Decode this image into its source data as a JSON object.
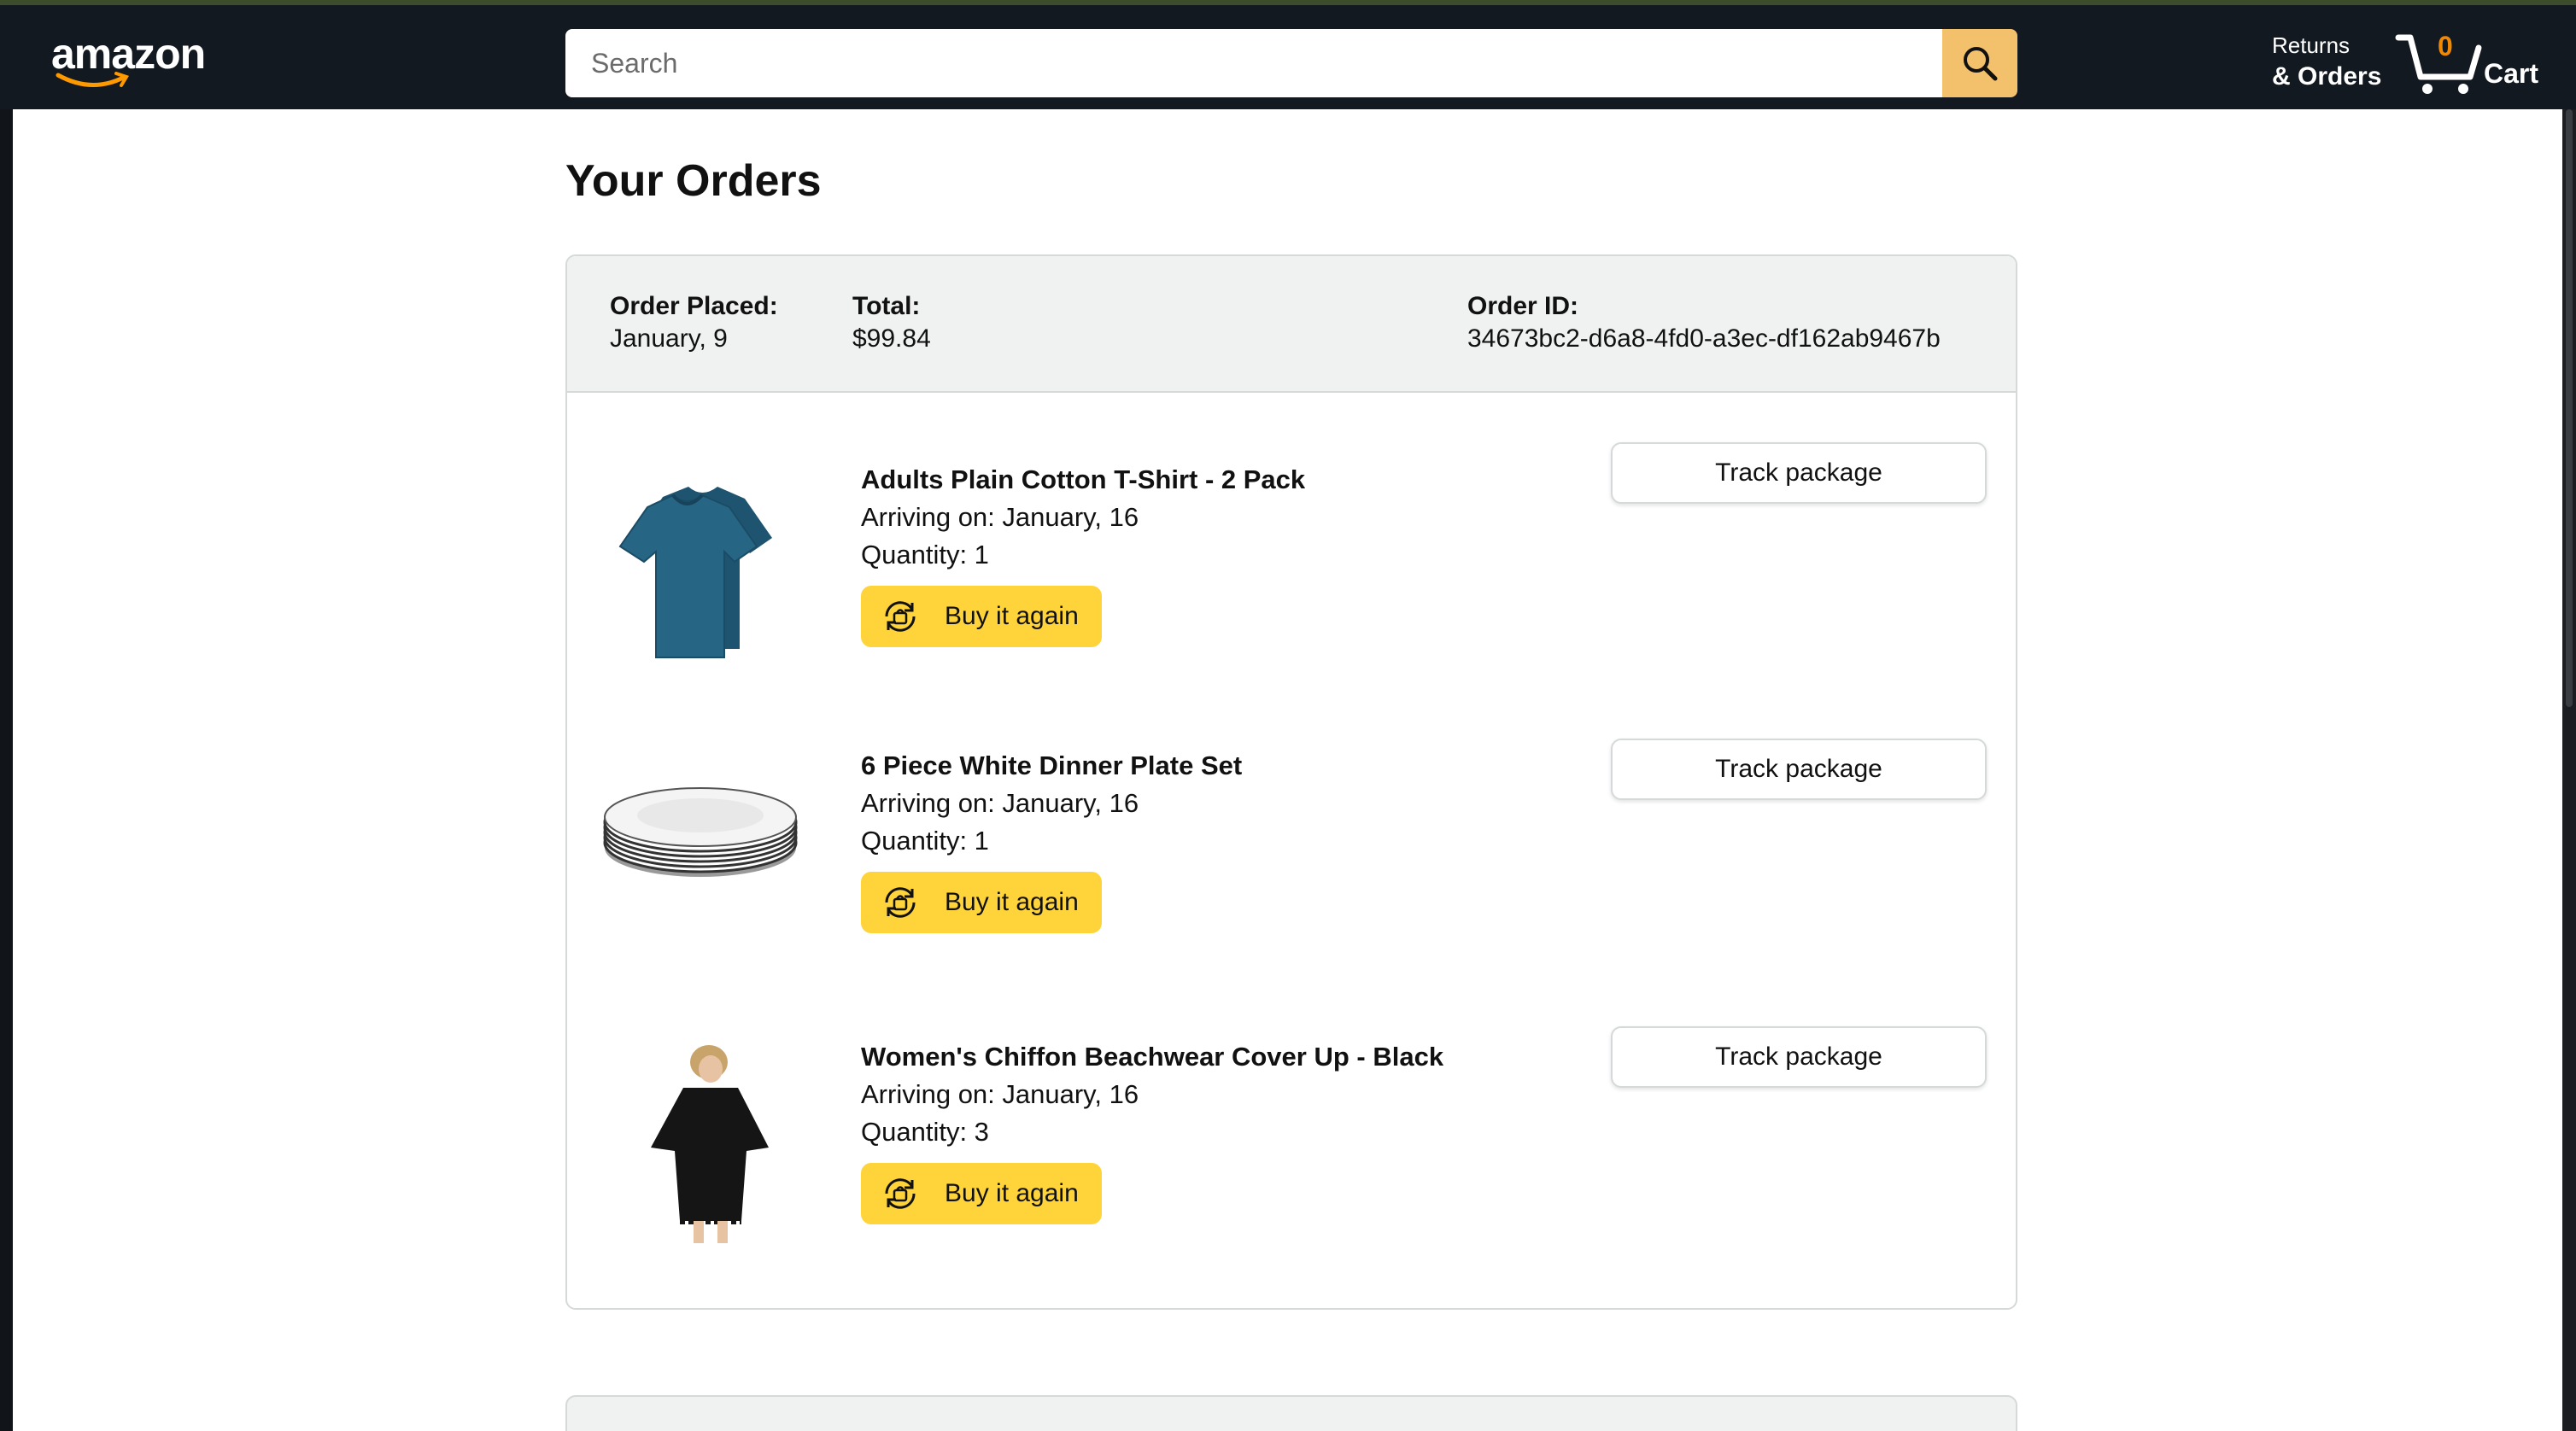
{
  "header": {
    "logo": "amazon",
    "search_placeholder": "Search",
    "returns_line1": "Returns",
    "returns_line2": "& Orders",
    "cart_count": "0",
    "cart_label": "Cart"
  },
  "page": {
    "title": "Your Orders"
  },
  "order": {
    "placed_label": "Order Placed:",
    "placed_value": "January, 9",
    "total_label": "Total:",
    "total_value": "$99.84",
    "id_label": "Order ID:",
    "id_value": "34673bc2-d6a8-4fd0-a3ec-df162ab9467b",
    "items": [
      {
        "title": "Adults Plain Cotton T-Shirt - 2 Pack",
        "arriving": "Arriving on: January, 16",
        "quantity": "Quantity: 1",
        "buy_again": "Buy it again",
        "track": "Track package",
        "image": "tshirt-image"
      },
      {
        "title": "6 Piece White Dinner Plate Set",
        "arriving": "Arriving on: January, 16",
        "quantity": "Quantity: 1",
        "buy_again": "Buy it again",
        "track": "Track package",
        "image": "plates-image"
      },
      {
        "title": "Women's Chiffon Beachwear Cover Up - Black",
        "arriving": "Arriving on: January, 16",
        "quantity": "Quantity: 3",
        "buy_again": "Buy it again",
        "track": "Track package",
        "image": "coverup-image"
      }
    ]
  },
  "colors": {
    "header_bg": "#131921",
    "search_button": "#f3c16c",
    "buy_again_button": "#ffd43b",
    "cart_count": "#f08804",
    "order_header_bg": "#f0f2f2"
  }
}
